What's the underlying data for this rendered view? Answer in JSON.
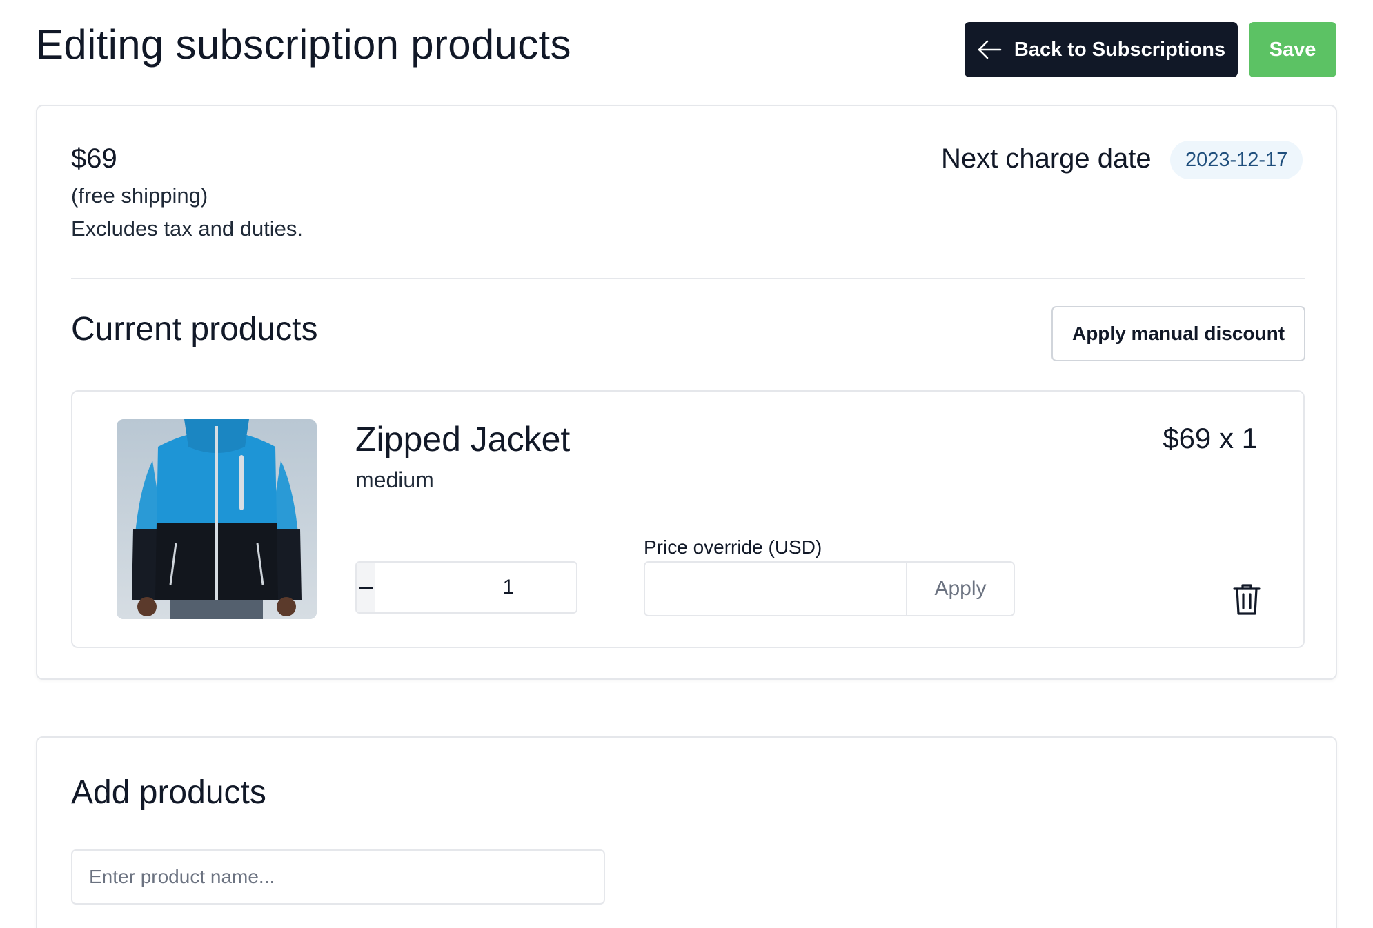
{
  "header": {
    "title": "Editing subscription products",
    "back_label": "Back to Subscriptions",
    "save_label": "Save"
  },
  "summary": {
    "price": "$69",
    "shipping_note": "(free shipping)",
    "tax_note": "Excludes tax and duties.",
    "next_charge_label": "Next charge date",
    "next_charge_date": "2023-12-17"
  },
  "current_products": {
    "title": "Current products",
    "discount_button": "Apply manual discount",
    "items": [
      {
        "name": "Zipped Jacket",
        "variant": "medium",
        "price_qty": "$69 x 1",
        "quantity": "1",
        "price_override_label": "Price override (USD)",
        "price_override_value": "",
        "apply_label": "Apply"
      }
    ]
  },
  "add_products": {
    "title": "Add products",
    "search_placeholder": "Enter product name..."
  },
  "icons": {
    "back": "arrow-left-icon",
    "decrement": "minus-icon",
    "increment": "plus-icon",
    "delete": "trash-icon"
  },
  "colors": {
    "primary_dark": "#111827",
    "save_green": "#5cc264",
    "badge_bg": "#eef6fc",
    "badge_text": "#1e4e7c"
  }
}
